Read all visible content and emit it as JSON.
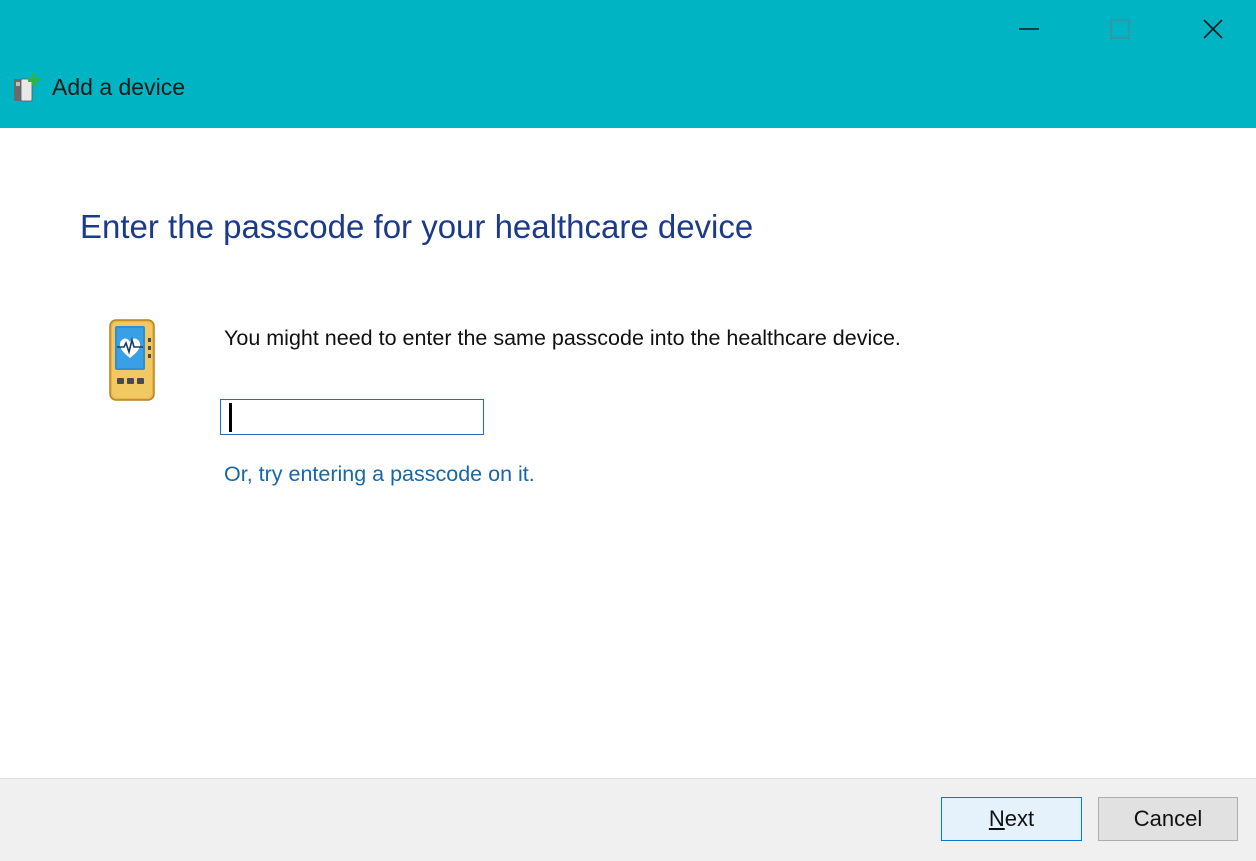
{
  "window": {
    "title": "Add a device",
    "titlebar_color": "#00b4c4",
    "controls": [
      "minimize-icon",
      "maximize-icon",
      "close-icon"
    ]
  },
  "main": {
    "heading": "Enter the passcode for your healthcare device",
    "instruction": "You might need to enter the same passcode into the healthcare device.",
    "passcode_value": "",
    "alt_link": "Or, try entering a passcode on it.",
    "device_icon": "healthcare-device-icon"
  },
  "footer": {
    "next_prefix": "N",
    "next_rest": "ext",
    "cancel_label": "Cancel"
  },
  "colors": {
    "heading": "#1c3a8a",
    "link": "#1767a8",
    "primary_button_border": "#0078d7"
  }
}
